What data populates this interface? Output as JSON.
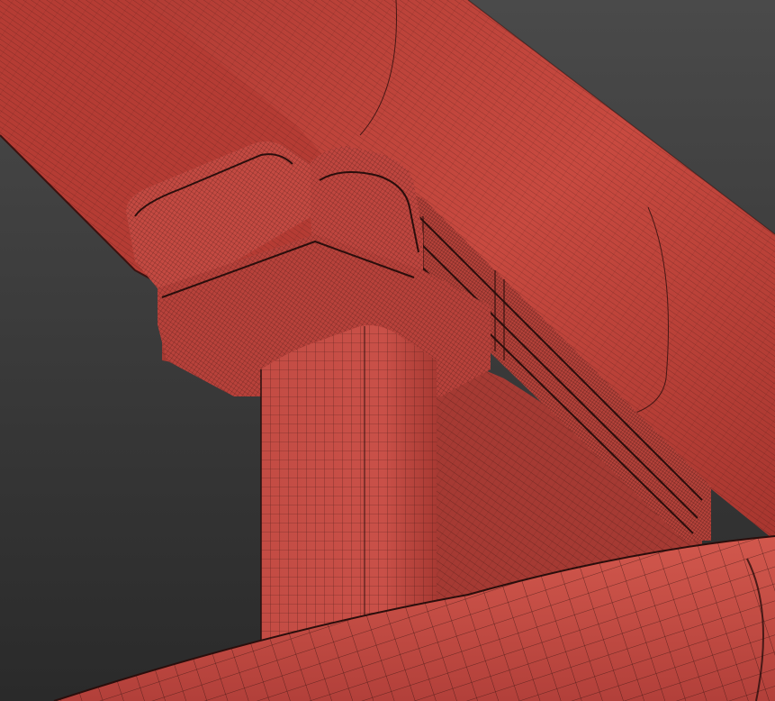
{
  "viewport": {
    "background_top": "#4a4a4a",
    "background_bottom": "#2a2a2a"
  },
  "colors": {
    "mesh_fill": "#c4473f",
    "mesh_fill_dark": "#8f2f2a",
    "mesh_fill_light": "#d5574c",
    "wire": "#2a0e0c",
    "shadow": "#5d1c18"
  },
  "scene": {
    "objects": [
      "upper-cylinder-beam",
      "rear-cylinder-beam",
      "bracket-block",
      "bracket-rails",
      "vertical-post",
      "lower-curved-tube"
    ]
  }
}
